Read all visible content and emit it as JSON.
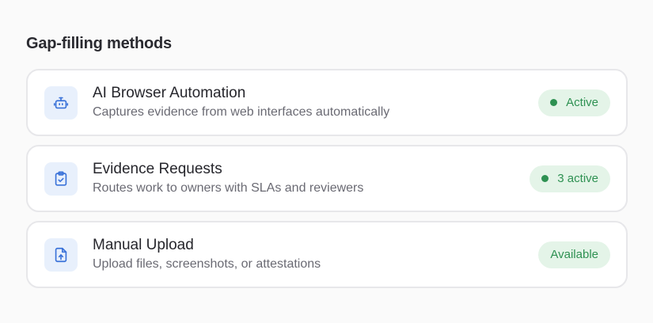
{
  "section": {
    "title": "Gap-filling methods"
  },
  "methods": [
    {
      "icon": "robot-icon",
      "title": "AI Browser Automation",
      "description": "Captures evidence from web interfaces automatically",
      "status": "Active",
      "status_dot": true
    },
    {
      "icon": "clipboard-check-icon",
      "title": "Evidence Requests",
      "description": "Routes work to owners with SLAs and reviewers",
      "status": "3 active",
      "status_dot": true
    },
    {
      "icon": "file-upload-icon",
      "title": "Manual Upload",
      "description": "Upload files, screenshots, or attestations",
      "status": "Available",
      "status_dot": false
    }
  ],
  "colors": {
    "icon_accent": "#3b73d9",
    "icon_bg": "#e8f0fc",
    "status_green": "#2e9152",
    "status_bg": "#e4f4e8"
  }
}
